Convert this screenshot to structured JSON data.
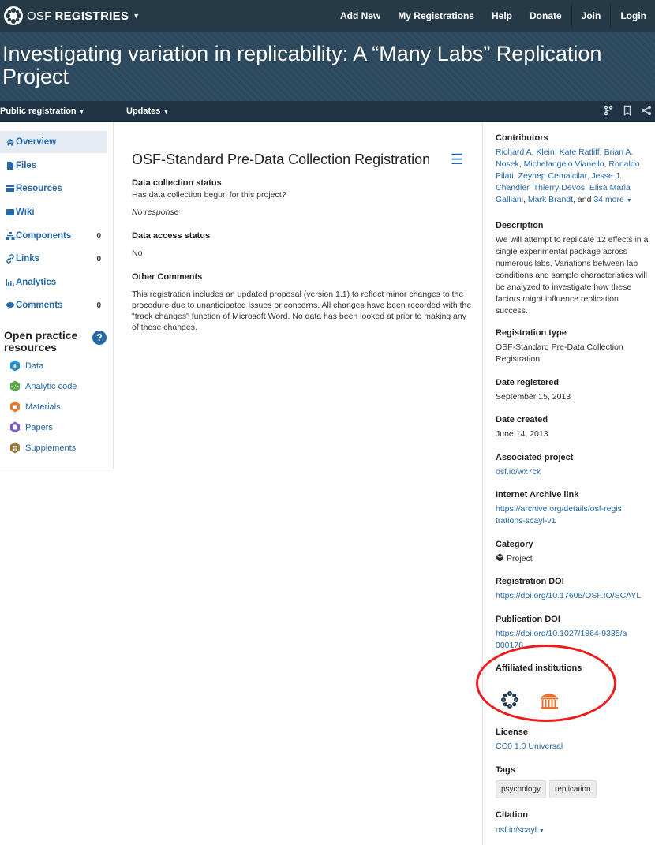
{
  "nav": {
    "brand_osf": "OSF",
    "brand_registries": "REGISTRIES",
    "links": [
      "Add New",
      "My Registrations",
      "Help",
      "Donate"
    ],
    "join": "Join",
    "login": "Login"
  },
  "hero": {
    "title": "Investigating variation in replicability: A “Many Labs” Replication Project"
  },
  "subnav": {
    "public_registration": "Public registration",
    "updates": "Updates"
  },
  "sidebar": {
    "items": [
      {
        "label": "Overview",
        "icon": "home-icon",
        "count": ""
      },
      {
        "label": "Files",
        "icon": "file-icon",
        "count": ""
      },
      {
        "label": "Resources",
        "icon": "resources-icon",
        "count": ""
      },
      {
        "label": "Wiki",
        "icon": "wiki-icon",
        "count": ""
      },
      {
        "label": "Components",
        "icon": "components-icon",
        "count": "0"
      },
      {
        "label": "Links",
        "icon": "link-icon",
        "count": "0"
      },
      {
        "label": "Analytics",
        "icon": "analytics-icon",
        "count": ""
      },
      {
        "label": "Comments",
        "icon": "comments-icon",
        "count": "0"
      }
    ],
    "open_practice_title": "Open practice resources",
    "open_practice_items": [
      {
        "label": "Data",
        "color": "#1f8fd6"
      },
      {
        "label": "Analytic code",
        "color": "#5aa745"
      },
      {
        "label": "Materials",
        "color": "#e8772a"
      },
      {
        "label": "Papers",
        "color": "#7d57c2"
      },
      {
        "label": "Supplements",
        "color": "#9c7a36"
      }
    ]
  },
  "main": {
    "title": "OSF-Standard Pre-Data Collection Registration",
    "fields": {
      "collection_status_label": "Data collection status",
      "collection_status_question": "Has data collection begun for this project?",
      "collection_status_value": "No response",
      "access_status_label": "Data access status",
      "access_status_value": "No",
      "other_comments_label": "Other Comments",
      "other_comments_value": "This registration includes an updated proposal (version 1.1) to reflect minor changes to the procedure due to unanticipated issues or concerns. All changes have been recorded with the \"track changes\" function of Microsoft Word. No data has been looked at prior to making any of these changes."
    }
  },
  "right": {
    "contributors_label": "Contributors",
    "contributors": [
      "Richard A. Klein",
      "Kate Ratliff",
      "Brian A. Nosek",
      "Michelangelo Vianello",
      "Ronaldo Pilati",
      "Zeynep Cemalcilar",
      "Jesse J. Chandler",
      "Thierry Devos",
      "Elisa Maria Galliani",
      "Mark Brandt"
    ],
    "contributors_and": ", and",
    "contributors_more": "34 more",
    "description_label": "Description",
    "description": "We will attempt to replicate 12 effects in a single experimental package across numerous labs. Variations between lab conditions and sample characteristics will be analyzed to investigate how these factors might influence replication success.",
    "registration_type_label": "Registration type",
    "registration_type": "OSF-Standard Pre-Data Collection Registration",
    "date_registered_label": "Date registered",
    "date_registered": "September 15, 2013",
    "date_created_label": "Date created",
    "date_created": "June 14, 2013",
    "associated_project_label": "Associated project",
    "associated_project": "osf.io/wx7ck",
    "internet_archive_label": "Internet Archive link",
    "internet_archive": "https://archive.org/details/osf-registrations-scayl-v1",
    "category_label": "Category",
    "category": "Project",
    "registration_doi_label": "Registration DOI",
    "registration_doi": "https://doi.org/10.17605/OSF.IO/SCAYL",
    "publication_doi_label": "Publication DOI",
    "publication_doi": "https://doi.org/10.1027/1864-9335/a000178",
    "affiliated_label": "Affiliated institutions",
    "license_label": "License",
    "license": "CC0 1.0 Universal",
    "tags_label": "Tags",
    "tags": [
      "psychology",
      "replication"
    ],
    "citation_label": "Citation",
    "citation": "osf.io/scayl"
  },
  "colors": {
    "topnav": "#263947",
    "hero": "#2e4a5f",
    "link": "#2569a8",
    "highlight_oval": "#ee1c1c"
  }
}
